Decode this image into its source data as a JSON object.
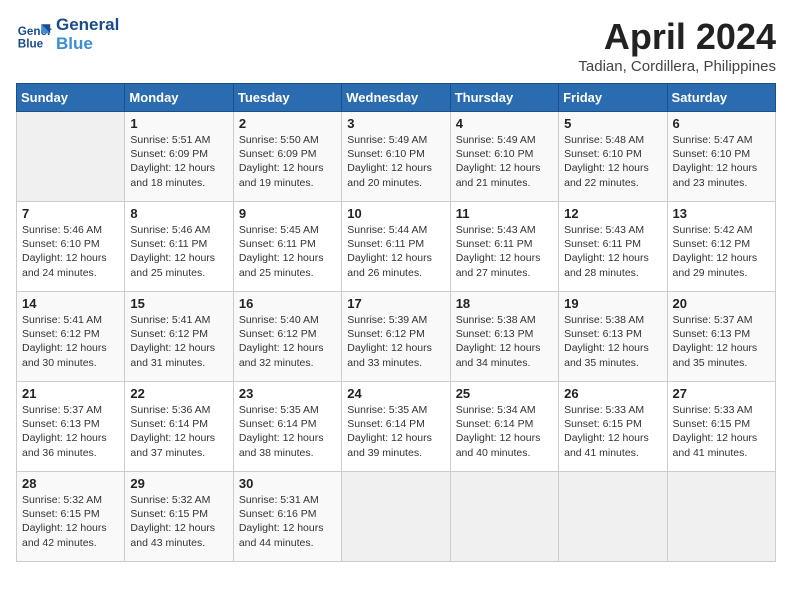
{
  "header": {
    "logo_line1": "General",
    "logo_line2": "Blue",
    "month": "April 2024",
    "location": "Tadian, Cordillera, Philippines"
  },
  "days_of_week": [
    "Sunday",
    "Monday",
    "Tuesday",
    "Wednesday",
    "Thursday",
    "Friday",
    "Saturday"
  ],
  "weeks": [
    [
      {
        "day": "",
        "info": ""
      },
      {
        "day": "1",
        "info": "Sunrise: 5:51 AM\nSunset: 6:09 PM\nDaylight: 12 hours\nand 18 minutes."
      },
      {
        "day": "2",
        "info": "Sunrise: 5:50 AM\nSunset: 6:09 PM\nDaylight: 12 hours\nand 19 minutes."
      },
      {
        "day": "3",
        "info": "Sunrise: 5:49 AM\nSunset: 6:10 PM\nDaylight: 12 hours\nand 20 minutes."
      },
      {
        "day": "4",
        "info": "Sunrise: 5:49 AM\nSunset: 6:10 PM\nDaylight: 12 hours\nand 21 minutes."
      },
      {
        "day": "5",
        "info": "Sunrise: 5:48 AM\nSunset: 6:10 PM\nDaylight: 12 hours\nand 22 minutes."
      },
      {
        "day": "6",
        "info": "Sunrise: 5:47 AM\nSunset: 6:10 PM\nDaylight: 12 hours\nand 23 minutes."
      }
    ],
    [
      {
        "day": "7",
        "info": "Sunrise: 5:46 AM\nSunset: 6:10 PM\nDaylight: 12 hours\nand 24 minutes."
      },
      {
        "day": "8",
        "info": "Sunrise: 5:46 AM\nSunset: 6:11 PM\nDaylight: 12 hours\nand 25 minutes."
      },
      {
        "day": "9",
        "info": "Sunrise: 5:45 AM\nSunset: 6:11 PM\nDaylight: 12 hours\nand 25 minutes."
      },
      {
        "day": "10",
        "info": "Sunrise: 5:44 AM\nSunset: 6:11 PM\nDaylight: 12 hours\nand 26 minutes."
      },
      {
        "day": "11",
        "info": "Sunrise: 5:43 AM\nSunset: 6:11 PM\nDaylight: 12 hours\nand 27 minutes."
      },
      {
        "day": "12",
        "info": "Sunrise: 5:43 AM\nSunset: 6:11 PM\nDaylight: 12 hours\nand 28 minutes."
      },
      {
        "day": "13",
        "info": "Sunrise: 5:42 AM\nSunset: 6:12 PM\nDaylight: 12 hours\nand 29 minutes."
      }
    ],
    [
      {
        "day": "14",
        "info": "Sunrise: 5:41 AM\nSunset: 6:12 PM\nDaylight: 12 hours\nand 30 minutes."
      },
      {
        "day": "15",
        "info": "Sunrise: 5:41 AM\nSunset: 6:12 PM\nDaylight: 12 hours\nand 31 minutes."
      },
      {
        "day": "16",
        "info": "Sunrise: 5:40 AM\nSunset: 6:12 PM\nDaylight: 12 hours\nand 32 minutes."
      },
      {
        "day": "17",
        "info": "Sunrise: 5:39 AM\nSunset: 6:12 PM\nDaylight: 12 hours\nand 33 minutes."
      },
      {
        "day": "18",
        "info": "Sunrise: 5:38 AM\nSunset: 6:13 PM\nDaylight: 12 hours\nand 34 minutes."
      },
      {
        "day": "19",
        "info": "Sunrise: 5:38 AM\nSunset: 6:13 PM\nDaylight: 12 hours\nand 35 minutes."
      },
      {
        "day": "20",
        "info": "Sunrise: 5:37 AM\nSunset: 6:13 PM\nDaylight: 12 hours\nand 35 minutes."
      }
    ],
    [
      {
        "day": "21",
        "info": "Sunrise: 5:37 AM\nSunset: 6:13 PM\nDaylight: 12 hours\nand 36 minutes."
      },
      {
        "day": "22",
        "info": "Sunrise: 5:36 AM\nSunset: 6:14 PM\nDaylight: 12 hours\nand 37 minutes."
      },
      {
        "day": "23",
        "info": "Sunrise: 5:35 AM\nSunset: 6:14 PM\nDaylight: 12 hours\nand 38 minutes."
      },
      {
        "day": "24",
        "info": "Sunrise: 5:35 AM\nSunset: 6:14 PM\nDaylight: 12 hours\nand 39 minutes."
      },
      {
        "day": "25",
        "info": "Sunrise: 5:34 AM\nSunset: 6:14 PM\nDaylight: 12 hours\nand 40 minutes."
      },
      {
        "day": "26",
        "info": "Sunrise: 5:33 AM\nSunset: 6:15 PM\nDaylight: 12 hours\nand 41 minutes."
      },
      {
        "day": "27",
        "info": "Sunrise: 5:33 AM\nSunset: 6:15 PM\nDaylight: 12 hours\nand 41 minutes."
      }
    ],
    [
      {
        "day": "28",
        "info": "Sunrise: 5:32 AM\nSunset: 6:15 PM\nDaylight: 12 hours\nand 42 minutes."
      },
      {
        "day": "29",
        "info": "Sunrise: 5:32 AM\nSunset: 6:15 PM\nDaylight: 12 hours\nand 43 minutes."
      },
      {
        "day": "30",
        "info": "Sunrise: 5:31 AM\nSunset: 6:16 PM\nDaylight: 12 hours\nand 44 minutes."
      },
      {
        "day": "",
        "info": ""
      },
      {
        "day": "",
        "info": ""
      },
      {
        "day": "",
        "info": ""
      },
      {
        "day": "",
        "info": ""
      }
    ]
  ]
}
